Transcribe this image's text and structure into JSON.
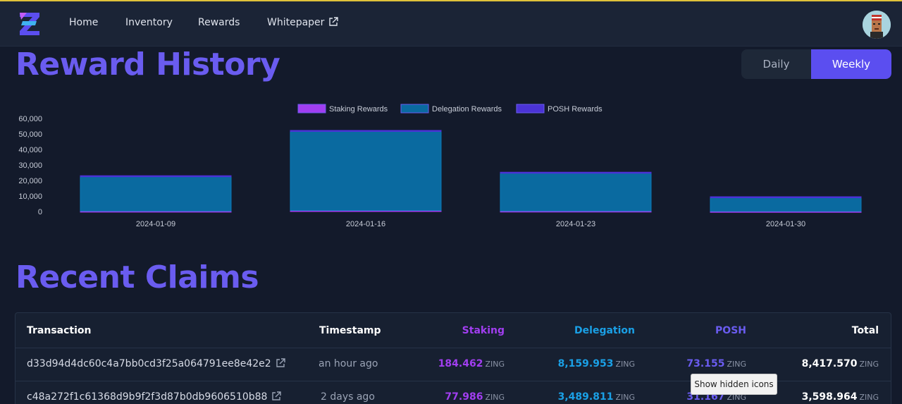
{
  "nav": {
    "links": [
      "Home",
      "Inventory",
      "Rewards",
      "Whitepaper"
    ]
  },
  "reward_history": {
    "title": "Reward History",
    "toggle": [
      "Daily",
      "Weekly"
    ],
    "active_toggle": "Weekly"
  },
  "chart_data": {
    "type": "bar",
    "stacked": true,
    "categories": [
      "2024-01-09",
      "2024-01-16",
      "2024-01-23",
      "2024-01-30"
    ],
    "series": [
      {
        "name": "Staking Rewards",
        "color": "#a13ef0",
        "values": [
          300,
          700,
          350,
          150
        ]
      },
      {
        "name": "Delegation Rewards",
        "color": "#0a6aa0",
        "values": [
          22500,
          51000,
          24700,
          9300
        ]
      },
      {
        "name": "POSH Rewards",
        "color": "#4b33d6",
        "values": [
          300,
          600,
          300,
          100
        ]
      }
    ],
    "yticks": [
      "60,000",
      "50,000",
      "40,000",
      "30,000",
      "20,000",
      "10,000",
      "0"
    ],
    "ylim": [
      0,
      60000
    ],
    "legend": "top-center",
    "grid": false
  },
  "recent_claims": {
    "title": "Recent Claims",
    "headers": {
      "transaction": "Transaction",
      "timestamp": "Timestamp",
      "staking": "Staking",
      "delegation": "Delegation",
      "posh": "POSH",
      "total": "Total"
    },
    "unit": "ZING",
    "rows": [
      {
        "tx": "d33d94d4dc60c4a7bb0cd3f25a064791ee8e42e2",
        "time": "an hour ago",
        "staking": "184.462",
        "delegation": "8,159.953",
        "posh": "73.155",
        "total": "8,417.570"
      },
      {
        "tx": "c48a272f1c61368d9b9f2f3d87b0db9606510b88",
        "time": "2 days ago",
        "staking": "77.986",
        "delegation": "3,489.811",
        "posh": "31.167",
        "total": "3,598.964"
      }
    ]
  },
  "tooltip": "Show hidden icons",
  "colors": {
    "accent": "#6a5cf0",
    "staking": "#a13ef0",
    "delegation": "#1aa0e6",
    "posh": "#6a5cf0"
  }
}
